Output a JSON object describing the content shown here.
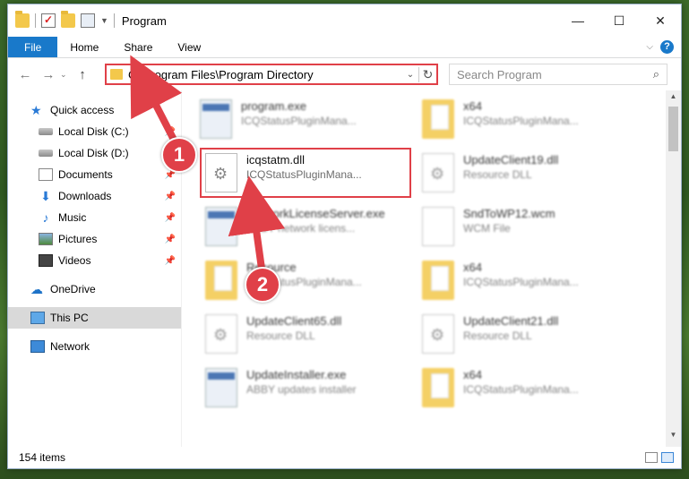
{
  "window": {
    "title": "Program",
    "controls": {
      "minimize": "—",
      "maximize": "☐",
      "close": "✕"
    }
  },
  "ribbon": {
    "tabs": [
      "File",
      "Home",
      "Share",
      "View"
    ]
  },
  "address": {
    "path": "C:\\Program Files\\Program Directory",
    "search_placeholder": "Search Program"
  },
  "nav": {
    "quick_access": "Quick access",
    "items": [
      {
        "label": "Local Disk (C:)",
        "icon": "drive-icon",
        "pinned": true
      },
      {
        "label": "Local Disk (D:)",
        "icon": "drive-icon",
        "pinned": false
      },
      {
        "label": "Documents",
        "icon": "documents-icon",
        "pinned": true
      },
      {
        "label": "Downloads",
        "icon": "downloads-icon",
        "pinned": true
      },
      {
        "label": "Music",
        "icon": "music-icon",
        "pinned": true
      },
      {
        "label": "Pictures",
        "icon": "pictures-icon",
        "pinned": true
      },
      {
        "label": "Videos",
        "icon": "videos-icon",
        "pinned": true
      }
    ],
    "onedrive": "OneDrive",
    "this_pc": "This PC",
    "network": "Network"
  },
  "files": [
    {
      "name": "program.exe",
      "desc": "ICQStatusPluginMana...",
      "icon": "exe-icon"
    },
    {
      "name": "x64",
      "desc": "ICQStatusPluginMana...",
      "icon": "folder-icon"
    },
    {
      "name": "icqstatm.dll",
      "desc": "ICQStatusPluginMana...",
      "icon": "dll-icon"
    },
    {
      "name": "UpdateClient19.dll",
      "desc": "Resource DLL",
      "icon": "dll-icon"
    },
    {
      "name": "NetworkLicenseServer.exe",
      "desc": "ABBY network licens...",
      "icon": "exe-icon"
    },
    {
      "name": "SndToWP12.wcm",
      "desc": "WCM File",
      "icon": "file-icon"
    },
    {
      "name": "Resource",
      "desc": "ICQStatusPluginMana...",
      "icon": "folder-icon"
    },
    {
      "name": "x64",
      "desc": "ICQStatusPluginMana...",
      "icon": "folder-icon"
    },
    {
      "name": "UpdateClient65.dll",
      "desc": "Resource DLL",
      "icon": "dll-icon"
    },
    {
      "name": "UpdateClient21.dll",
      "desc": "Resource DLL",
      "icon": "dll-icon"
    },
    {
      "name": "UpdateInstaller.exe",
      "desc": "ABBY updates installer",
      "icon": "exe-icon"
    },
    {
      "name": "x64",
      "desc": "ICQStatusPluginMana...",
      "icon": "folder-icon"
    }
  ],
  "status": {
    "count": "154 items"
  },
  "callouts": [
    "1",
    "2"
  ],
  "colors": {
    "accent": "#1979ca",
    "highlight": "#e04048"
  }
}
